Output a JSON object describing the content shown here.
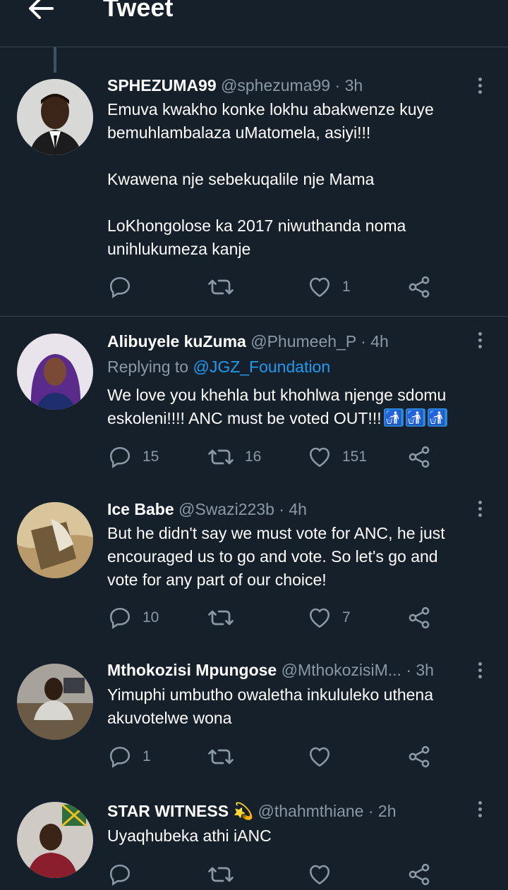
{
  "header": {
    "title": "Tweet"
  },
  "tweets": [
    {
      "name": "SPHEZUMA99",
      "handle": "@sphezuma99",
      "time": "3h",
      "body": "Emuva kwakho konke lokhu abakwenze kuye\nbemuhlambalaza uMatomela, asiyi!!!\n\nKwawena nje sebekuqalile nje Mama\n\nLoKhongolose ka 2017 niwuthanda noma\nunihlukumeza kanje",
      "replies": "",
      "retweets": "",
      "likes": "1"
    },
    {
      "name": "Alibuyele kuZuma",
      "handle": "@Phumeeh_P",
      "time": "4h",
      "reply_prefix": "Replying to",
      "reply_mention": "@JGZ_Foundation",
      "body": "We love you khehla but khohlwa njenge sdomu\neskoleni!!!! ANC must be voted OUT!!!",
      "replies": "15",
      "retweets": "16",
      "likes": "151"
    },
    {
      "name": "Ice Babe",
      "handle": "@Swazi223b",
      "time": "4h",
      "body": "But he didn't say we must vote for ANC, he just\nencouraged us to go and vote. So let's go and\nvote for any part of our choice!",
      "replies": "10",
      "retweets": "",
      "likes": "7"
    },
    {
      "name": "Mthokozisi Mpungose",
      "handle": "@MthokozisiM...",
      "time": "3h",
      "body": "Yimuphi umbutho owaletha inkululeko uthena\nakuvotelwe wona",
      "replies": "1",
      "retweets": "",
      "likes": ""
    },
    {
      "name": "STAR WITNESS",
      "name_emoji": "💫",
      "handle": "@thahmthiane",
      "time": "2h",
      "body": "Uyaqhubeka athi iANC",
      "replies": "",
      "retweets": "",
      "likes": ""
    }
  ],
  "dot": "·",
  "icons": [
    "back-arrow-icon",
    "more-icon",
    "reply-icon",
    "retweet-icon",
    "like-icon",
    "share-icon",
    "wastebasket-emoji-icon",
    "dizzy-emoji-icon"
  ],
  "colors": {
    "background": "#15202b",
    "muted": "#8b98a5",
    "link": "#1d9bf0",
    "divider": "#38444d"
  }
}
